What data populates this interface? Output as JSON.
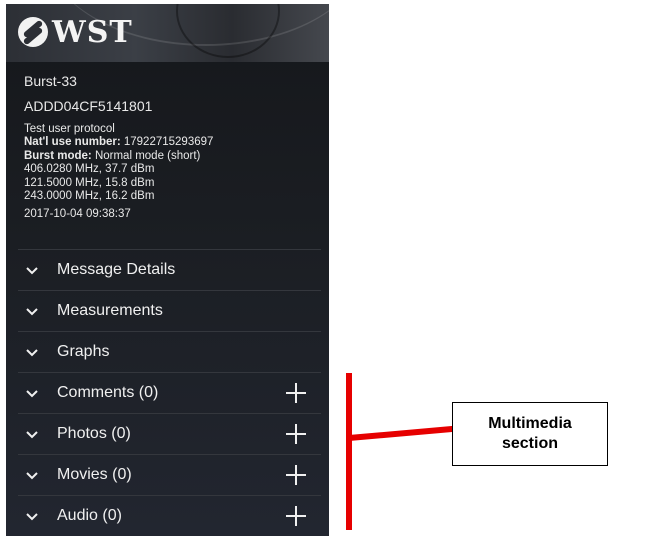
{
  "header": {
    "brand": "WST",
    "logo_icon": "wst-swoosh-logo-icon"
  },
  "beacon": {
    "name": "Burst-33",
    "id": "ADDD04CF5141801",
    "protocol": "Test user protocol",
    "nat_use_label": "Nat'l use number:",
    "nat_use_value": "17922715293697",
    "burst_mode_label": "Burst mode:",
    "burst_mode_value": "Normal mode (short)",
    "freq1": "406.0280 MHz, 37.7 dBm",
    "freq2": "121.5000 MHz, 15.8 dBm",
    "freq3": "243.0000 MHz, 16.2 dBm",
    "timestamp": "2017-10-04 09:38:37"
  },
  "sections": [
    {
      "label": "Message Details",
      "icon": "chevron-down-icon"
    },
    {
      "label": "Measurements",
      "icon": "chevron-down-icon"
    },
    {
      "label": "Graphs",
      "icon": "chevron-down-icon"
    },
    {
      "label": "Comments (0)",
      "icon": "chevron-down-icon",
      "action_icon": "plus-icon"
    },
    {
      "label": "Photos (0)",
      "icon": "chevron-down-icon",
      "action_icon": "plus-icon"
    },
    {
      "label": "Movies (0)",
      "icon": "chevron-down-icon",
      "action_icon": "plus-icon"
    },
    {
      "label": "Audio (0)",
      "icon": "chevron-down-icon",
      "action_icon": "plus-icon"
    }
  ],
  "callout": {
    "line1": "Multimedia",
    "line2": "section",
    "accent_color": "#e60000"
  }
}
